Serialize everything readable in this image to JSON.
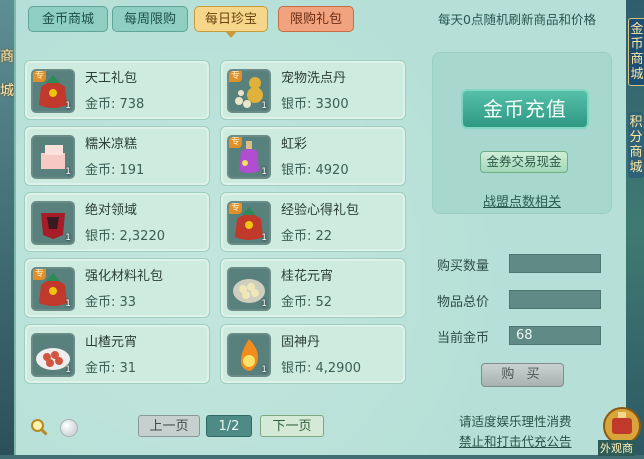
{
  "tabs": [
    {
      "label": "金币商城",
      "state": "normal"
    },
    {
      "label": "每周限购",
      "state": "normal"
    },
    {
      "label": "每日珍宝",
      "state": "active"
    },
    {
      "label": "限购礼包",
      "state": "gift"
    }
  ],
  "notice": "每天0点随机刷新商品和价格",
  "left_strip_text": [
    "商",
    "城"
  ],
  "right_tab_text": [
    "金",
    "币",
    "商",
    "城"
  ],
  "right_tab2_text": [
    "积",
    "分",
    "商",
    "城"
  ],
  "items": [
    {
      "name": "天工礼包",
      "price_label": "金币: 738",
      "icon": "gift-bag-icon",
      "qty": "1",
      "tag": "专"
    },
    {
      "name": "宠物洗点丹",
      "price_label": "银币: 3300",
      "icon": "pill-gourd-icon",
      "qty": "1",
      "tag": "专"
    },
    {
      "name": "糯米凉糕",
      "price_label": "金币: 191",
      "icon": "rice-cake-icon",
      "qty": "1",
      "tag": ""
    },
    {
      "name": "虹彩",
      "price_label": "银币: 4920",
      "icon": "potion-bottle-icon",
      "qty": "1",
      "tag": "专"
    },
    {
      "name": "绝对领域",
      "price_label": "银币: 2,3220",
      "icon": "red-armor-icon",
      "qty": "1",
      "tag": ""
    },
    {
      "name": "经验心得礼包",
      "price_label": "金币: 22",
      "icon": "gift-bag-icon",
      "qty": "1",
      "tag": "专"
    },
    {
      "name": "强化材料礼包",
      "price_label": "金币: 33",
      "icon": "gift-bag-icon",
      "qty": "1",
      "tag": "专"
    },
    {
      "name": "桂花元宵",
      "price_label": "金币: 52",
      "icon": "dumpling-bowl-icon",
      "qty": "1",
      "tag": ""
    },
    {
      "name": "山楂元宵",
      "price_label": "金币: 31",
      "icon": "dumpling-plate-icon",
      "qty": "1",
      "tag": ""
    },
    {
      "name": "固神丹",
      "price_label": "银币: 4,2900",
      "icon": "fire-orb-icon",
      "qty": "1",
      "tag": ""
    }
  ],
  "pager": {
    "prev": "上一页",
    "page": "1/2",
    "next": "下一页"
  },
  "recharge_label": "金币充值",
  "exchange_label": "金券交易现金",
  "alliance_label": "战盟点数相关",
  "form": {
    "qty_label": "购买数量",
    "qty_value": "",
    "total_label": "物品总价",
    "total_value": "",
    "current_label": "当前金币",
    "current_value": "68"
  },
  "buy_label": "购 买",
  "footer": {
    "line1": "请适度娱乐理性消费",
    "line2": "禁止和打击代充公告"
  },
  "float_label": "外观商",
  "colors": {
    "panel": "#b6e0d7",
    "active_tab": "#f5d68a",
    "gift_tab": "#f0a37e",
    "recharge": "#2f9883"
  }
}
